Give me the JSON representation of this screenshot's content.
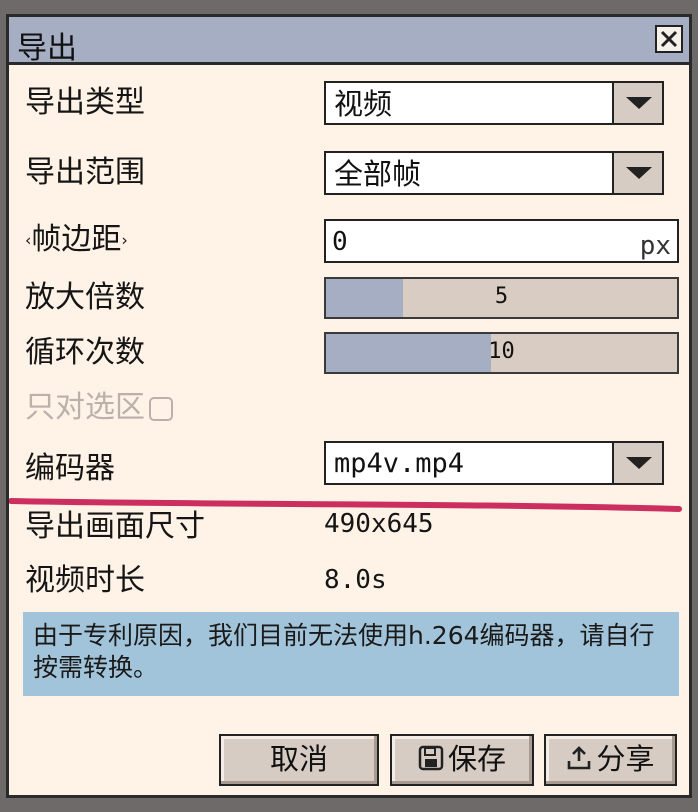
{
  "dialog": {
    "title": "导出"
  },
  "form": {
    "export_type": {
      "label": "导出类型",
      "value": "视频"
    },
    "export_range": {
      "label": "导出范围",
      "value": "全部帧"
    },
    "frame_margin": {
      "label_prefix": "‹",
      "label": "帧边距",
      "label_suffix": "›",
      "value": "0",
      "unit": "px"
    },
    "scale": {
      "label": "放大倍数",
      "value": "5",
      "fill_fraction": 0.22
    },
    "loop_count": {
      "label": "循环次数",
      "value": "10",
      "fill_fraction": 0.47
    },
    "selection_only": {
      "label": "只对选区",
      "checked": false
    },
    "encoder": {
      "label": "编码器",
      "value": "mp4v.mp4"
    }
  },
  "info": {
    "frame_size": {
      "label": "导出画面尺寸",
      "value": "490x645"
    },
    "duration": {
      "label": "视频时长",
      "value": "8.0s"
    }
  },
  "notice": "由于专利原因，我们目前无法使用h.264编码器，请自行按需转换。",
  "buttons": {
    "cancel": "取消",
    "save": "保存",
    "share": "分享"
  },
  "colors": {
    "accent": "#a5aec3",
    "notice_bg": "#a2c4da",
    "annotation": "#cc2f5f",
    "dialog_bg": "#fff2e6"
  }
}
